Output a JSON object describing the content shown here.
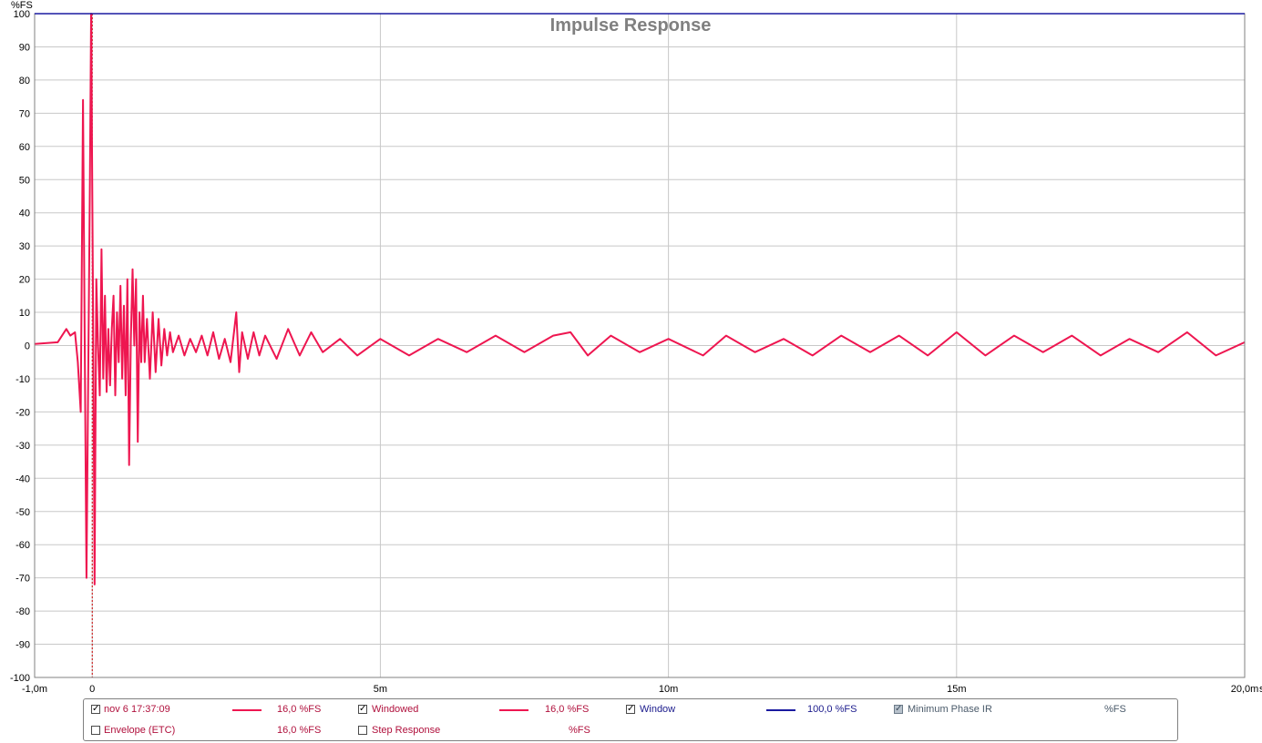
{
  "chart_data": {
    "type": "line",
    "title": "Impulse Response",
    "ylabel": "%FS",
    "xunit": "s",
    "xlim": [
      -1.0,
      20.0
    ],
    "ylim": [
      -100,
      100
    ],
    "xticks": [
      {
        "v": -1.0,
        "label": "-1,0m"
      },
      {
        "v": 0,
        "label": "0"
      },
      {
        "v": 5,
        "label": "5m"
      },
      {
        "v": 10,
        "label": "10m"
      },
      {
        "v": 15,
        "label": "15m"
      },
      {
        "v": 20,
        "label": "20,0m"
      }
    ],
    "yticks": [
      100,
      90,
      80,
      70,
      60,
      50,
      40,
      30,
      20,
      10,
      0,
      -10,
      -20,
      -30,
      -40,
      -50,
      -60,
      -70,
      -80,
      -90,
      -100
    ],
    "grid": true,
    "markers": [
      {
        "x": 0,
        "color": "#cc0000",
        "style": "dashed"
      }
    ],
    "series": [
      {
        "name": "nov 6 17:37:09",
        "color": "#ee1650",
        "x": [
          -1.0,
          -0.6,
          -0.45,
          -0.38,
          -0.3,
          -0.25,
          -0.2,
          -0.16,
          -0.13,
          -0.1,
          -0.07,
          -0.04,
          -0.02,
          0.0,
          0.02,
          0.04,
          0.07,
          0.1,
          0.13,
          0.16,
          0.19,
          0.22,
          0.25,
          0.28,
          0.31,
          0.34,
          0.37,
          0.4,
          0.43,
          0.46,
          0.49,
          0.52,
          0.55,
          0.58,
          0.61,
          0.64,
          0.67,
          0.7,
          0.73,
          0.76,
          0.79,
          0.82,
          0.85,
          0.88,
          0.91,
          0.95,
          1.0,
          1.05,
          1.1,
          1.15,
          1.2,
          1.25,
          1.3,
          1.35,
          1.4,
          1.5,
          1.6,
          1.7,
          1.8,
          1.9,
          2.0,
          2.1,
          2.2,
          2.3,
          2.4,
          2.5,
          2.55,
          2.6,
          2.7,
          2.8,
          2.9,
          3.0,
          3.2,
          3.4,
          3.6,
          3.8,
          4.0,
          4.3,
          4.6,
          5.0,
          5.5,
          6.0,
          6.5,
          7.0,
          7.5,
          8.0,
          8.3,
          8.6,
          9.0,
          9.5,
          10.0,
          10.6,
          11.0,
          11.5,
          12.0,
          12.5,
          13.0,
          13.5,
          14.0,
          14.5,
          15.0,
          15.5,
          16.0,
          16.5,
          17.0,
          17.5,
          18.0,
          18.5,
          19.0,
          19.5,
          20.0
        ],
        "values": [
          0.5,
          1,
          5,
          3,
          4,
          -5,
          -20,
          74,
          0,
          -70,
          -10,
          50,
          100,
          50,
          -5,
          -72,
          20,
          0,
          -15,
          29,
          -10,
          15,
          -14,
          5,
          -12,
          5,
          15,
          -15,
          10,
          -5,
          18,
          -10,
          12,
          -15,
          20,
          -36,
          2,
          23,
          0,
          20,
          -29,
          10,
          -5,
          15,
          -5,
          8,
          -10,
          10,
          -8,
          8,
          -6,
          5,
          -3,
          4,
          -2,
          3,
          -3,
          2,
          -2,
          3,
          -3,
          4,
          -4,
          2,
          -5,
          10,
          -8,
          4,
          -4,
          4,
          -3,
          3,
          -4,
          5,
          -3,
          4,
          -2,
          2,
          -3,
          2,
          -3,
          2,
          -2,
          3,
          -2,
          3,
          4,
          -3,
          3,
          -2,
          2,
          -3,
          3,
          -2,
          2,
          -3,
          3,
          -2,
          3,
          -3,
          4,
          -3,
          3,
          -2,
          3,
          -3,
          2,
          -2,
          4,
          -3,
          1
        ]
      }
    ]
  },
  "legend": {
    "row1": [
      {
        "label": "nov 6 17:37:09",
        "checked": true,
        "swatch": "#ee1650",
        "value": "16,0 %FS",
        "text_color": "#b0103c"
      },
      {
        "label": "Windowed",
        "checked": true,
        "swatch": "#ee1650",
        "value": "16,0 %FS",
        "text_color": "#b0103c"
      },
      {
        "label": "Window",
        "checked": true,
        "swatch": "#1a1aa0",
        "value": "100,0 %FS",
        "text_color": "#1a1a8c"
      },
      {
        "label": "Minimum Phase IR",
        "checked": "grey",
        "value": "%FS",
        "text_color": "#4a5a6a"
      }
    ],
    "row2": [
      {
        "label": "Envelope (ETC)",
        "checked": false,
        "value": "16,0 %FS",
        "text_color": "#b0103c"
      },
      {
        "label": "Step Response",
        "checked": false,
        "value": "%FS",
        "text_color": "#b0103c"
      }
    ]
  }
}
